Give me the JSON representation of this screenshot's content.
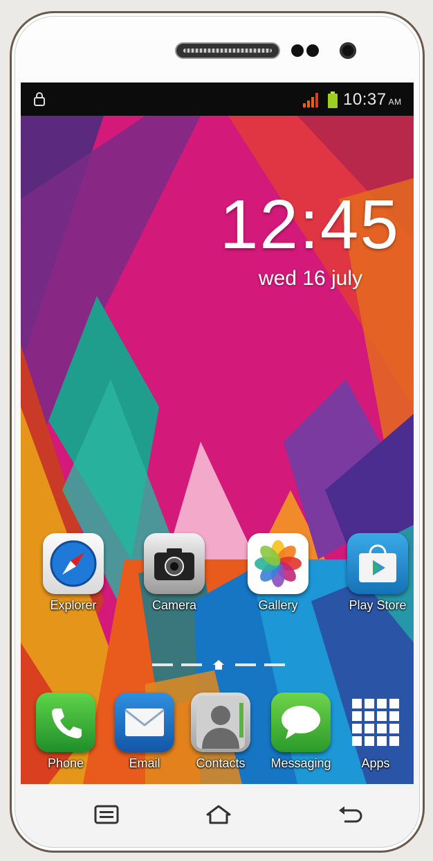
{
  "status_bar": {
    "time": "10:37",
    "ampm": "AM"
  },
  "lockscreen": {
    "clock": "12:45",
    "date": "wed 16 july"
  },
  "apps_row1": [
    {
      "label": "Explorer",
      "icon": "compass-icon"
    },
    {
      "label": "Camera",
      "icon": "camera-icon"
    },
    {
      "label": "Gallery",
      "icon": "flower-icon"
    },
    {
      "label": "Play Store",
      "icon": "play-store-icon"
    }
  ],
  "apps_dock": [
    {
      "label": "Phone",
      "icon": "phone-icon"
    },
    {
      "label": "Email",
      "icon": "envelope-icon"
    },
    {
      "label": "Contacts",
      "icon": "contact-icon"
    },
    {
      "label": "Messaging",
      "icon": "speech-bubble-icon"
    },
    {
      "label": "Apps",
      "icon": "grid-icon"
    }
  ],
  "colors": {
    "wallpaper_magenta": "#d3197a",
    "statusbar": "#0c0c0c",
    "phone_body": "#fdfdfd"
  }
}
